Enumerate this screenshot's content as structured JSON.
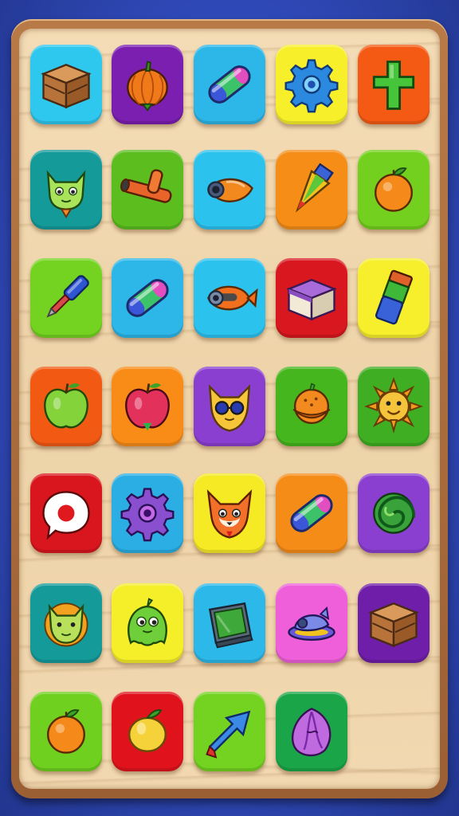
{
  "board": {
    "tiles": [
      {
        "icon": "wooden-crate-icon",
        "bg": "#2ec7ee"
      },
      {
        "icon": "pumpkin-icon",
        "bg": "#7a1fb0"
      },
      {
        "icon": "battery-capsule-icon",
        "bg": "#2db6e8"
      },
      {
        "icon": "gear-icon",
        "bg": "#f6ef2a"
      },
      {
        "icon": "green-cross-icon",
        "bg": "#f55a14"
      },
      {
        "icon": "cat-face-icon",
        "bg": "#159a9a"
      },
      {
        "icon": "pipe-connector-icon",
        "bg": "#5bbd1e"
      },
      {
        "icon": "orange-fish-icon",
        "bg": "#2cc2ee"
      },
      {
        "icon": "pencil-cone-icon",
        "bg": "#f58d17"
      },
      {
        "icon": "orange-fruit-icon",
        "bg": "#73d01f"
      },
      {
        "icon": "screwdriver-icon",
        "bg": "#74d321"
      },
      {
        "icon": "battery-capsule-icon",
        "bg": "#2db6e8"
      },
      {
        "icon": "goggle-fish-icon",
        "bg": "#2cc2ee"
      },
      {
        "icon": "purple-box-icon",
        "bg": "#d8171f"
      },
      {
        "icon": "glue-stick-icon",
        "bg": "#f7ef2c"
      },
      {
        "icon": "green-apple-icon",
        "bg": "#f25a14"
      },
      {
        "icon": "red-apple-icon",
        "bg": "#f88c17"
      },
      {
        "icon": "fox-sunglasses-icon",
        "bg": "#8a3fd0"
      },
      {
        "icon": "orange-bell-icon",
        "bg": "#45b61d"
      },
      {
        "icon": "sun-face-icon",
        "bg": "#3fae22"
      },
      {
        "icon": "speech-bubble-icon",
        "bg": "#d9161e"
      },
      {
        "icon": "purple-gear-icon",
        "bg": "#2aaee3"
      },
      {
        "icon": "fox-face-icon",
        "bg": "#f6ea25"
      },
      {
        "icon": "battery-capsule-icon",
        "bg": "#f68c18"
      },
      {
        "icon": "green-swirl-icon",
        "bg": "#8a3fd0"
      },
      {
        "icon": "lion-face-icon",
        "bg": "#159a9a"
      },
      {
        "icon": "green-monster-icon",
        "bg": "#f5ef2a"
      },
      {
        "icon": "tablet-screen-icon",
        "bg": "#2cb9ea"
      },
      {
        "icon": "ufo-fish-icon",
        "bg": "#ee5fd9"
      },
      {
        "icon": "wooden-crate-icon",
        "bg": "#6e1ea8"
      },
      {
        "icon": "orange-fruit-icon",
        "bg": "#6fd01f"
      },
      {
        "icon": "lemon-icon",
        "bg": "#e0131c"
      },
      {
        "icon": "blue-arrow-icon",
        "bg": "#74d321"
      },
      {
        "icon": "purple-shell-icon",
        "bg": "#1aa648"
      }
    ]
  }
}
